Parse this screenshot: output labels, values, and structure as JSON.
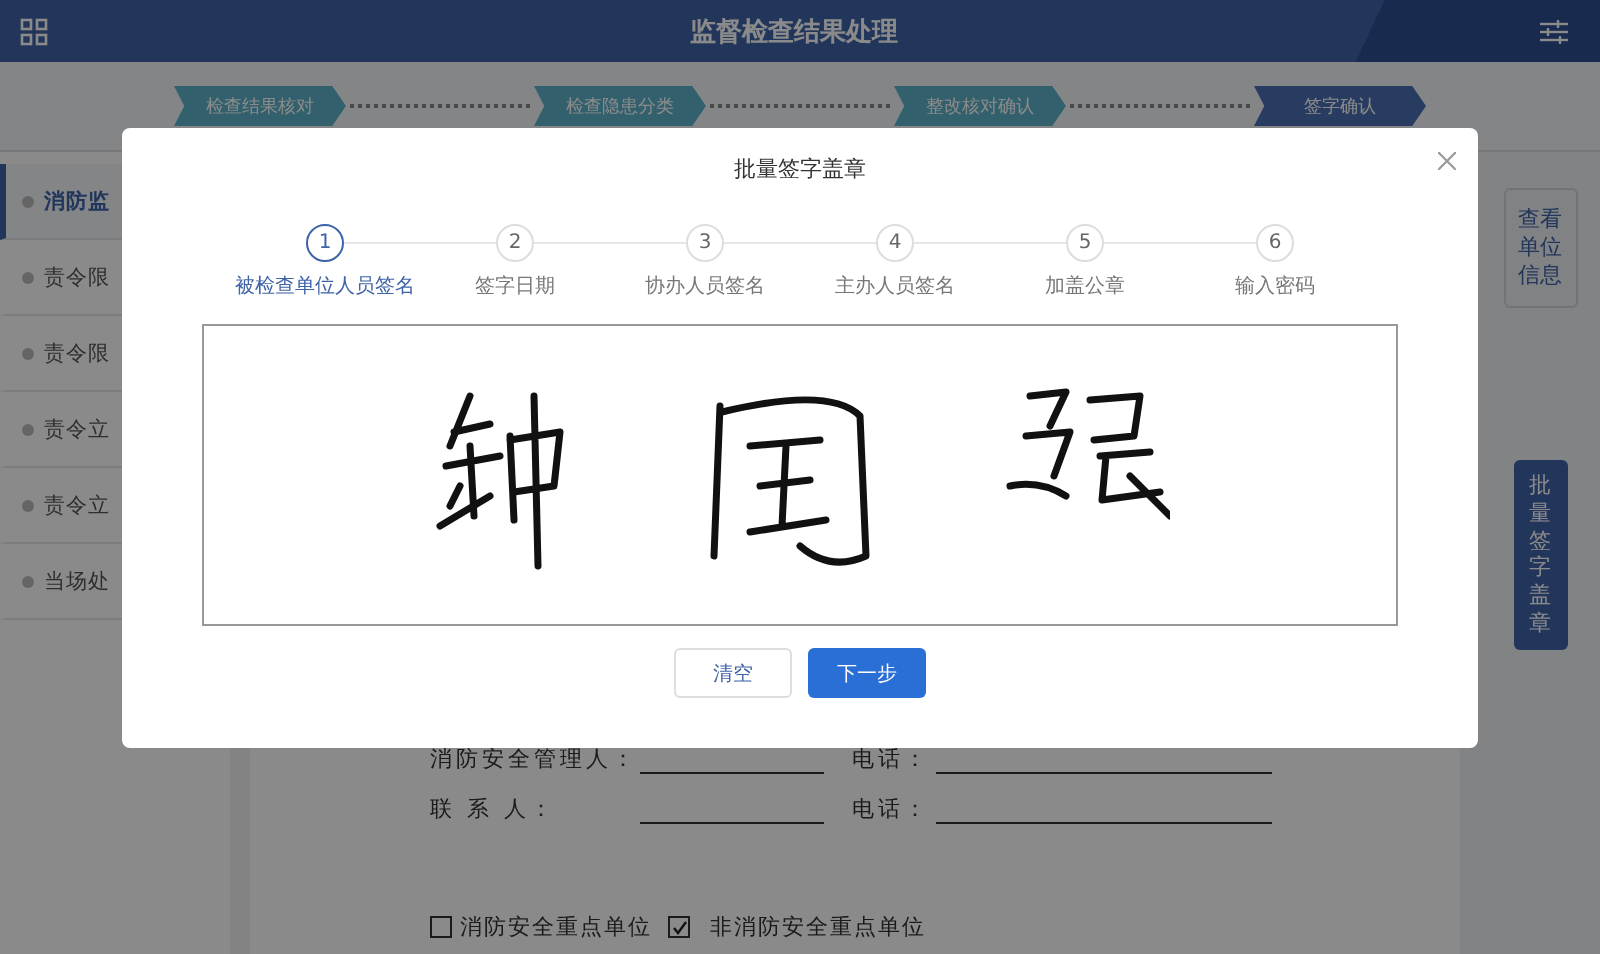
{
  "header": {
    "title": "监督检查结果处理"
  },
  "progress": [
    {
      "label": "检查结果核对",
      "selected": false
    },
    {
      "label": "检查隐患分类",
      "selected": false
    },
    {
      "label": "整改核对确认",
      "selected": false
    },
    {
      "label": "签字确认",
      "selected": true
    }
  ],
  "sidebar": {
    "items": [
      {
        "label": "消防监",
        "selected": true
      },
      {
        "label": "责令限",
        "selected": false
      },
      {
        "label": "责令限",
        "selected": false
      },
      {
        "label": "责令立",
        "selected": false
      },
      {
        "label": "责令立",
        "selected": false
      },
      {
        "label": "当场处",
        "selected": false
      }
    ]
  },
  "side_buttons": [
    {
      "label": "查看单位信息",
      "kind": "outline"
    },
    {
      "label": "批量签字盖章",
      "kind": "filled"
    }
  ],
  "form": {
    "rows": [
      {
        "label": "消防安全管理人：",
        "phone_label": "电话："
      },
      {
        "label": "联 系 人：",
        "phone_label": "电话："
      }
    ],
    "checkboxes": [
      {
        "label": "消防安全重点单位",
        "checked": false
      },
      {
        "label": "非消防安全重点单位",
        "checked": true
      }
    ]
  },
  "dialog": {
    "title": "批量签字盖章",
    "steps": [
      {
        "number": "1",
        "label": "被检查单位人员签名",
        "selected": true
      },
      {
        "number": "2",
        "label": "签字日期",
        "selected": false
      },
      {
        "number": "3",
        "label": "协办人员签名",
        "selected": false
      },
      {
        "number": "4",
        "label": "主办人员签名",
        "selected": false
      },
      {
        "number": "5",
        "label": "加盖公章",
        "selected": false
      },
      {
        "number": "6",
        "label": "输入密码",
        "selected": false
      }
    ],
    "buttons": [
      {
        "label": "清空",
        "kind": "secondary"
      },
      {
        "label": "下一步",
        "kind": "primary"
      }
    ]
  }
}
